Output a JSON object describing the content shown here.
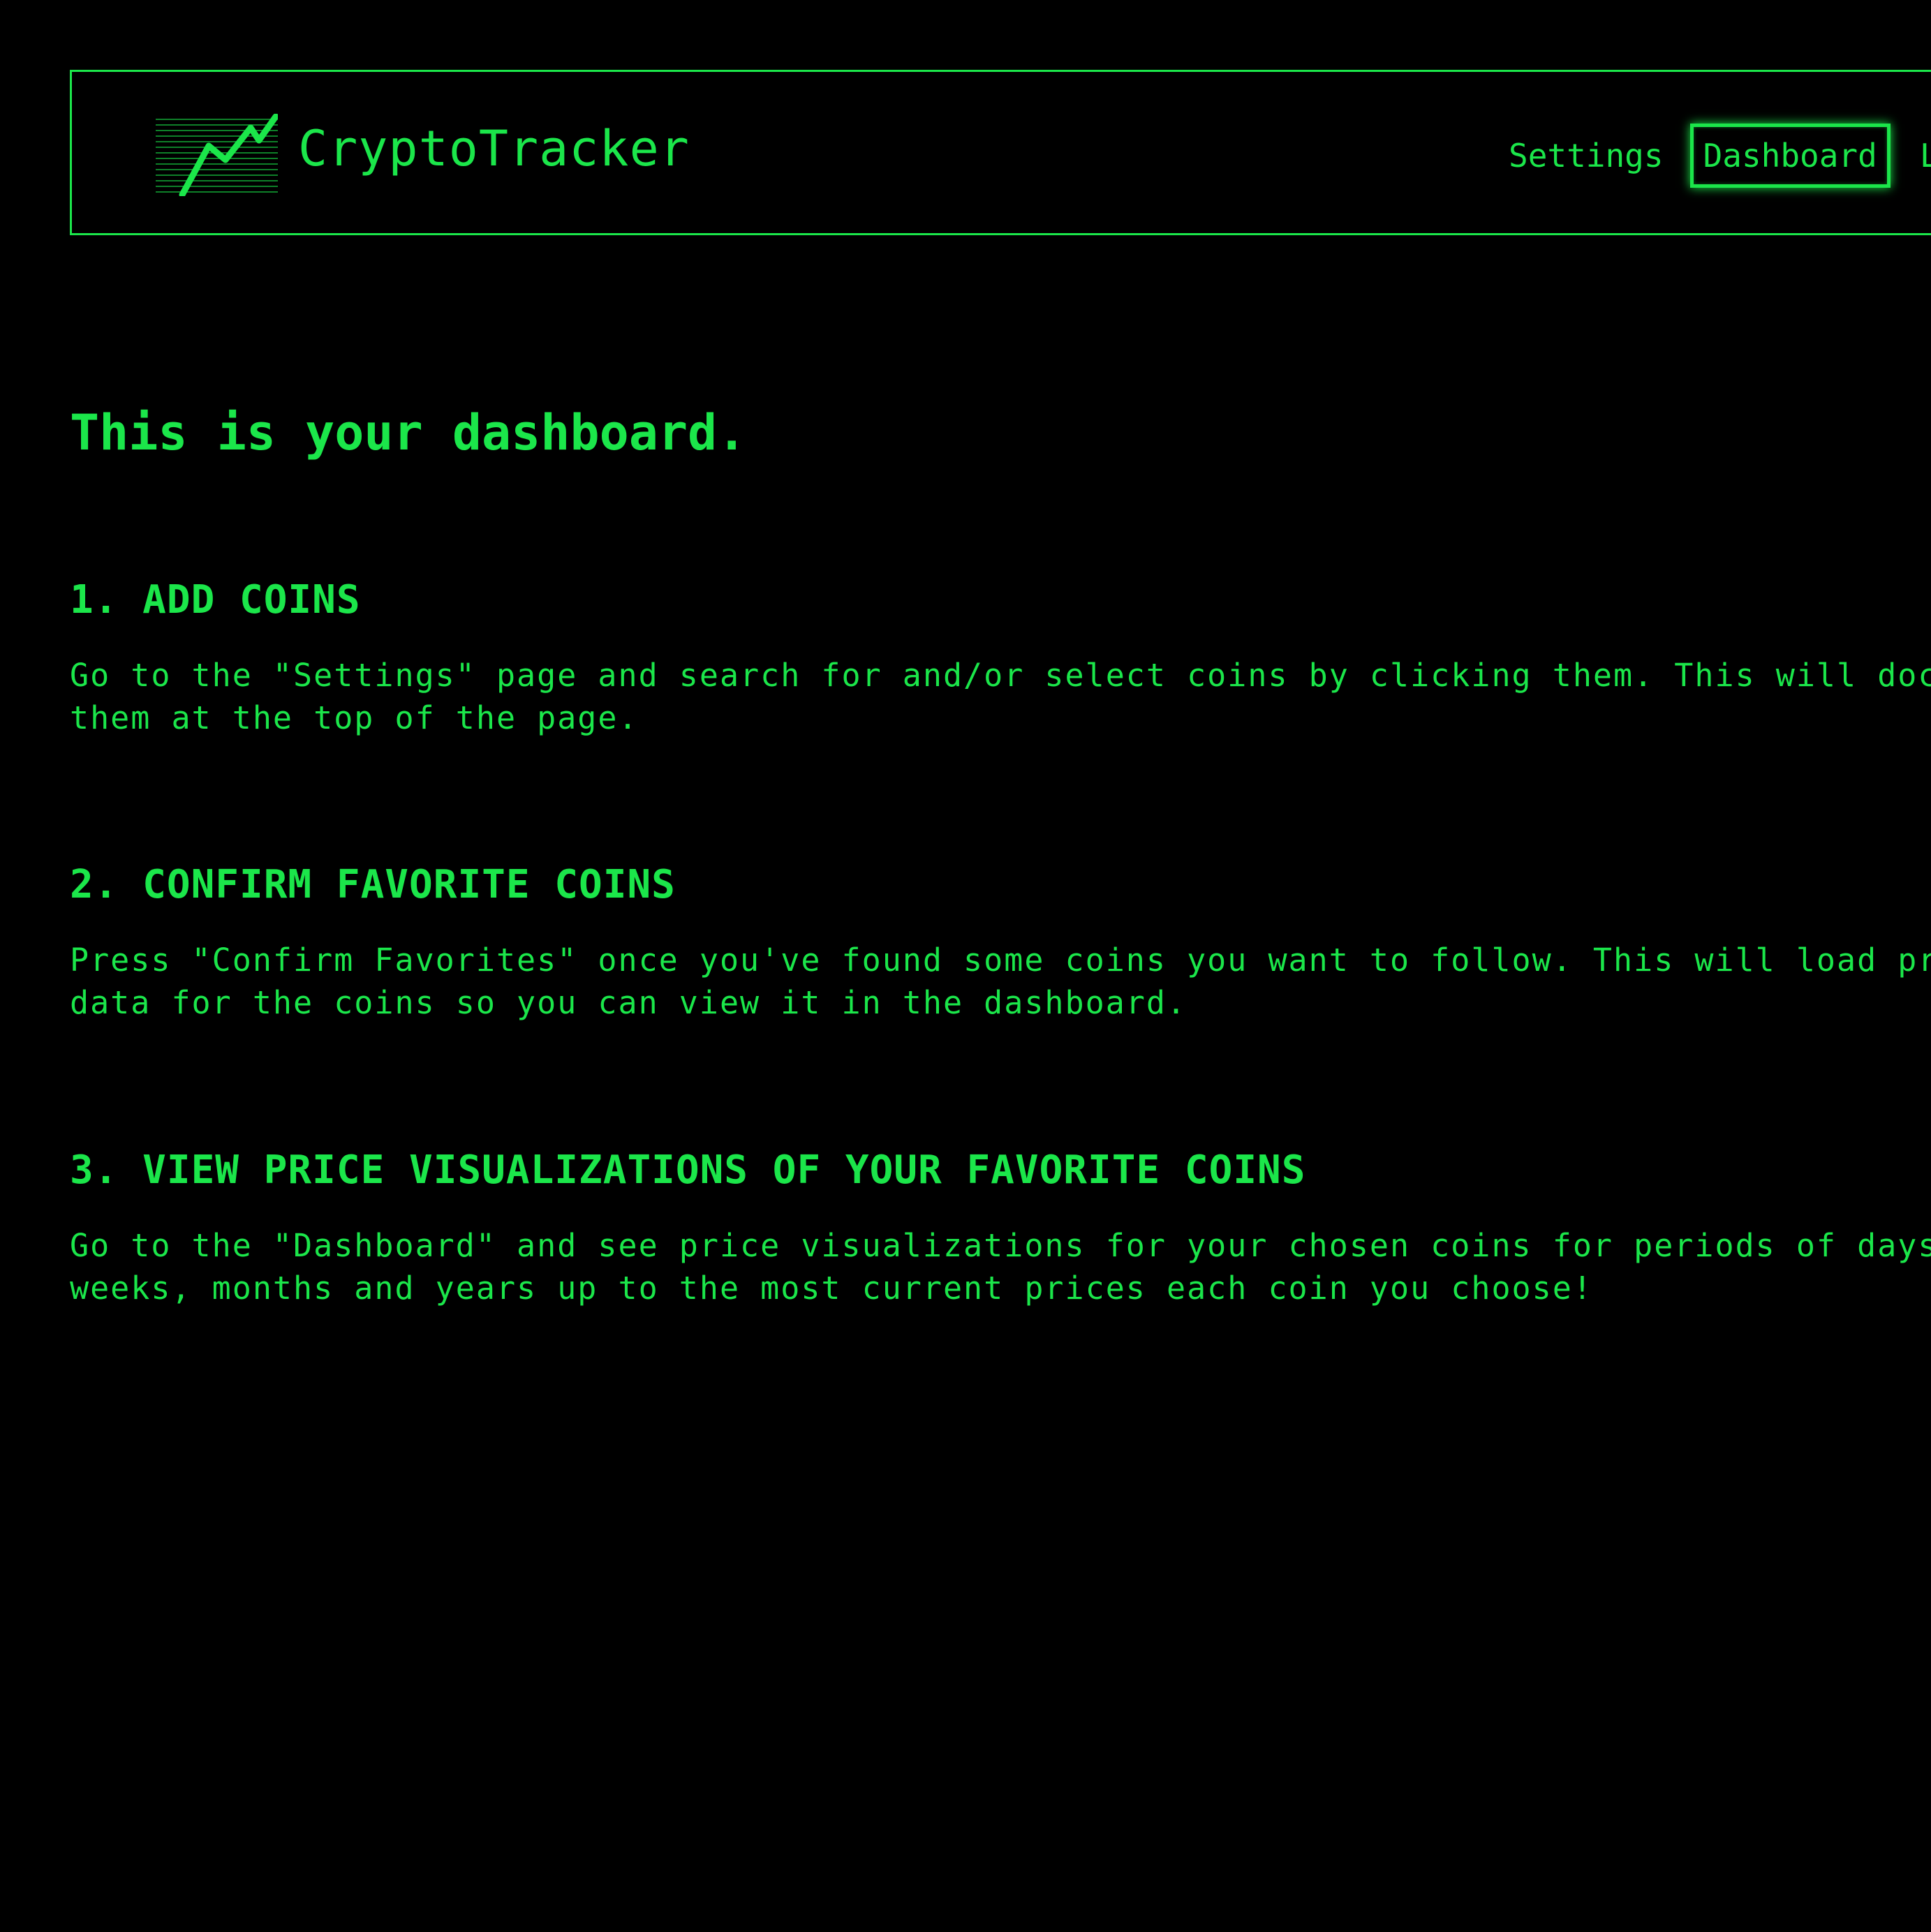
{
  "app": {
    "brand": "CryptoTracker",
    "accent_color": "#1be64a",
    "background_color": "#000000",
    "logo_icon": "trend-chart-icon"
  },
  "nav": {
    "settings": "Settings",
    "dashboard": "Dashboard",
    "partial_item": "L"
  },
  "main": {
    "title": "This is your dashboard.",
    "steps": [
      {
        "heading": "1. ADD COINS",
        "text": "Go to the \"Settings\" page and search for and/or select coins by clicking them. This will dock them at the top of the page."
      },
      {
        "heading": "2. CONFIRM FAVORITE COINS",
        "text": "Press \"Confirm Favorites\" once you've found some coins you want to follow. This will load price data for the coins so you can view it in the dashboard."
      },
      {
        "heading": "3. VIEW PRICE VISUALIZATIONS OF YOUR FAVORITE COINS",
        "text": "Go to the \"Dashboard\" and see price visualizations for your chosen coins for periods of days, weeks, months and years up to the most current prices each coin you choose!"
      }
    ]
  }
}
